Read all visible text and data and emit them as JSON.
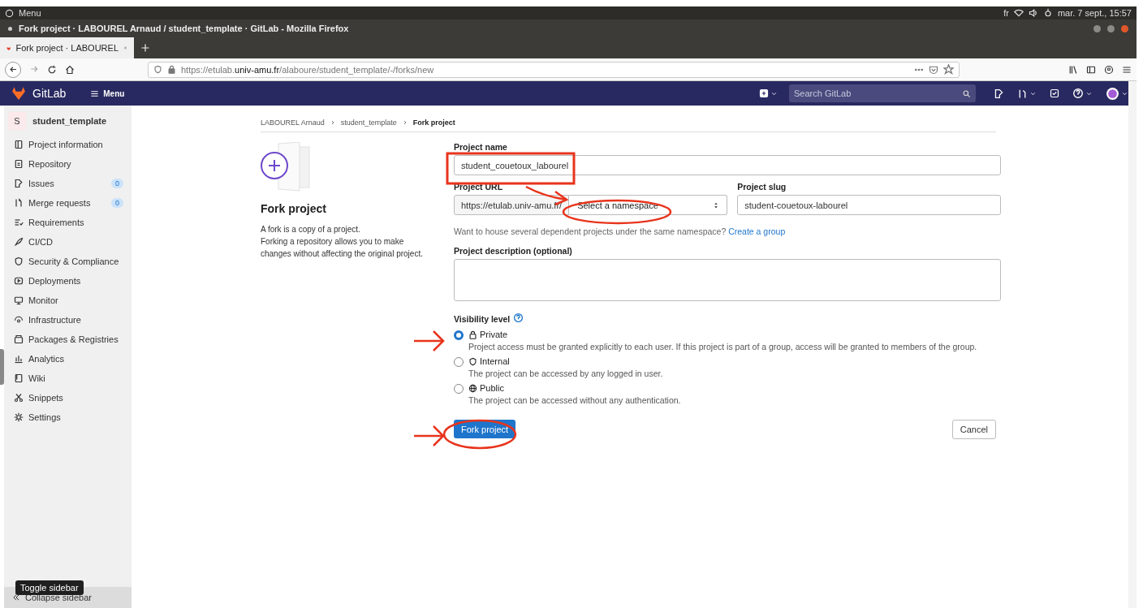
{
  "os_bar": {
    "menu": "Menu",
    "keyboard": "fr",
    "clock": "mar. 7 sept., 15:57"
  },
  "window": {
    "title": "Fork project · LABOUREL Arnaud / student_template · GitLab - Mozilla Firefox"
  },
  "tabs": [
    {
      "label": "Fork project · LABOUREL",
      "selected": true
    }
  ],
  "address_bar": {
    "url_prefix": "https://etulab.",
    "url_domain": "univ-amu.fr",
    "url_path": "/alaboure/student_template/-/forks/new"
  },
  "header": {
    "brand": "GitLab",
    "menu": "Menu",
    "search": {
      "placeholder": "Search GitLab"
    }
  },
  "sidebar": {
    "project_initial": "S",
    "project_name": "student_template",
    "items": [
      {
        "label": "Project information"
      },
      {
        "label": "Repository"
      },
      {
        "label": "Issues",
        "badge": "0"
      },
      {
        "label": "Merge requests",
        "badge": "0"
      },
      {
        "label": "Requirements"
      },
      {
        "label": "CI/CD"
      },
      {
        "label": "Security & Compliance"
      },
      {
        "label": "Deployments"
      },
      {
        "label": "Monitor"
      },
      {
        "label": "Infrastructure"
      },
      {
        "label": "Packages & Registries"
      },
      {
        "label": "Analytics"
      },
      {
        "label": "Wiki"
      },
      {
        "label": "Snippets"
      },
      {
        "label": "Settings"
      }
    ],
    "collapse": "Collapse sidebar",
    "tooltip": "Toggle sidebar"
  },
  "breadcrumb": [
    "LABOUREL Arnaud",
    "student_template",
    "Fork project"
  ],
  "intro": {
    "title": "Fork project",
    "paragraphs": [
      "A fork is a copy of a project.",
      "Forking a repository allows you to make changes without affecting the original project."
    ]
  },
  "form": {
    "project_name": {
      "label": "Project name",
      "value": "student_couetoux_labourel"
    },
    "project_url": {
      "label": "Project URL",
      "prefix": "https://etulab.univ-amu.fr/",
      "namespace": "Select a namespace"
    },
    "project_slug": {
      "label": "Project slug",
      "value": "student-couetoux-labourel"
    },
    "hint": {
      "text": "Want to house several dependent projects under the same namespace?",
      "link": "Create a group"
    },
    "description": {
      "label": "Project description (optional)"
    },
    "visibility": {
      "label": "Visibility level",
      "options": [
        {
          "label": "Private",
          "description": "Project access must be granted explicitly to each user. If this project is part of a group, access will be granted to members of the group.",
          "selected": true
        },
        {
          "label": "Internal",
          "description": "The project can be accessed by any logged in user.",
          "selected": false
        },
        {
          "label": "Public",
          "description": "The project can be accessed without any authentication.",
          "selected": false
        }
      ]
    },
    "submit": "Fork project",
    "cancel": "Cancel"
  }
}
